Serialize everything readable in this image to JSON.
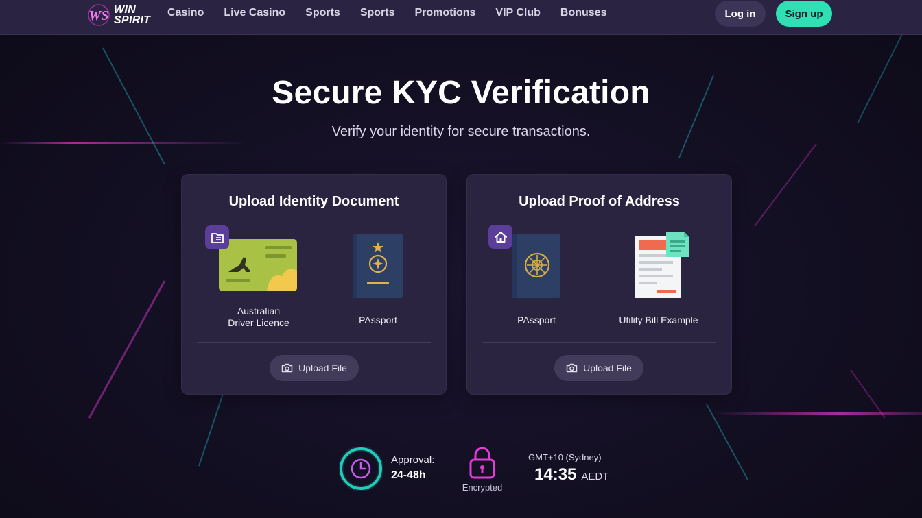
{
  "brand": {
    "name_line1": "WIN",
    "name_line2": "SPIRIT",
    "mark": "WS"
  },
  "nav": {
    "items": [
      "Casino",
      "Live Casino",
      "Sports",
      "Sports",
      "Promotions",
      "VIP Club",
      "Bonuses"
    ],
    "login_label": "Log in",
    "signup_label": "Sign up"
  },
  "hero": {
    "title": "Secure KYC Verification",
    "subtitle": "Verify your identity for secure transactions."
  },
  "identity_card": {
    "title": "Upload Identity Document",
    "badge_icon": "folder-icon",
    "docs": [
      {
        "label_line1": "Australian",
        "label_line2": "Driver Licence",
        "icon": "driver-licence-icon"
      },
      {
        "label": "PAssport",
        "icon": "passport-icon"
      }
    ],
    "upload_label": "Upload File"
  },
  "address_card": {
    "title": "Upload Proof of Address",
    "badge_icon": "home-icon",
    "docs": [
      {
        "label": "PAssport",
        "icon": "passport-icon"
      },
      {
        "label": "Utility Bill Example",
        "icon": "utility-bill-icon"
      }
    ],
    "upload_label": "Upload File"
  },
  "status": {
    "approval_label": "Approval:",
    "approval_value": "24-48h",
    "encrypted_label": "Encrypted",
    "timezone_label": "GMT+10 (Sydney)",
    "time_value": "14:35",
    "time_zone": "AEDT"
  },
  "colors": {
    "accent_teal": "#2fe0b4",
    "accent_purple": "#5b3e9a",
    "neon_pink": "#e23bd6",
    "neon_cyan": "#23d9e6",
    "card_bg": "#2b2440",
    "header_bg": "#2a2342"
  }
}
